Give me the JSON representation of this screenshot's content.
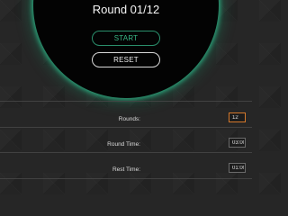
{
  "timer": {
    "round_label": "Round 01/12",
    "start_label": "START",
    "reset_label": "RESET"
  },
  "settings": {
    "rounds": {
      "label": "Rounds:",
      "value": "12"
    },
    "round_time": {
      "label": "Round Time:",
      "value": "03:00"
    },
    "rest_time": {
      "label": "Rest Time:",
      "value": "01:00"
    }
  },
  "colors": {
    "accent_green": "#38b987",
    "glow_green": "#2a9a74",
    "focus_orange": "#d4782b"
  }
}
